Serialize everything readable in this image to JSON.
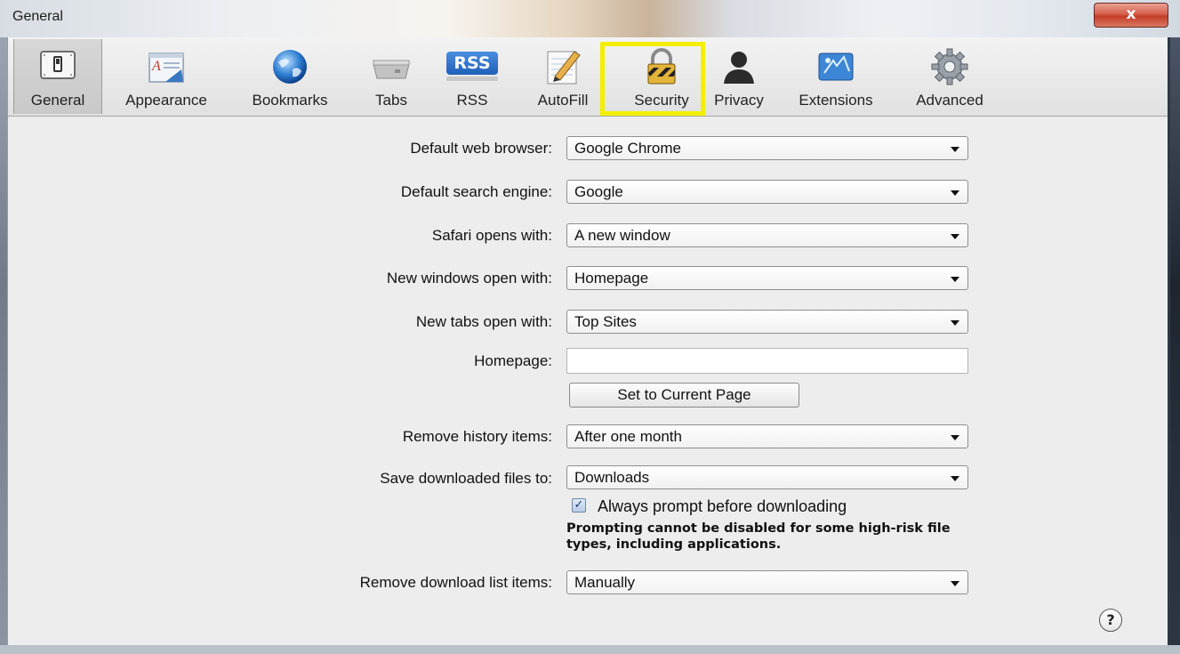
{
  "window": {
    "title": "General",
    "close_label": "x"
  },
  "toolbar": {
    "items": [
      {
        "label": "General",
        "icon": "general-switch-icon",
        "selected": true
      },
      {
        "label": "Appearance",
        "icon": "appearance-icon"
      },
      {
        "label": "Bookmarks",
        "icon": "globe-icon"
      },
      {
        "label": "Tabs",
        "icon": "tabs-icon"
      },
      {
        "label": "RSS",
        "icon": "rss-icon"
      },
      {
        "label": "AutoFill",
        "icon": "autofill-pencil-icon"
      },
      {
        "label": "Security",
        "icon": "padlock-icon",
        "highlighted": true
      },
      {
        "label": "Privacy",
        "icon": "person-silhouette-icon"
      },
      {
        "label": "Extensions",
        "icon": "extensions-icon"
      },
      {
        "label": "Advanced",
        "icon": "gear-icon"
      }
    ],
    "rss_badge": "RSS",
    "highlight_color": "#f4ef00"
  },
  "form": {
    "default_browser": {
      "label": "Default web browser:",
      "value": "Google Chrome"
    },
    "search_engine": {
      "label": "Default search engine:",
      "value": "Google"
    },
    "safari_opens": {
      "label": "Safari opens with:",
      "value": "A new window"
    },
    "new_windows": {
      "label": "New windows open with:",
      "value": "Homepage"
    },
    "new_tabs": {
      "label": "New tabs open with:",
      "value": "Top Sites"
    },
    "homepage": {
      "label": "Homepage:",
      "value": "",
      "button": "Set to Current Page"
    },
    "remove_history": {
      "label": "Remove history items:",
      "value": "After one month"
    },
    "save_downloads": {
      "label": "Save downloaded files to:",
      "value": "Downloads"
    },
    "always_prompt": {
      "checked": true,
      "check_mark": "✓",
      "label": "Always prompt before downloading",
      "note": "Prompting cannot be disabled for some high-risk file types, including applications."
    },
    "remove_download_list": {
      "label": "Remove download list items:",
      "value": "Manually"
    }
  },
  "help": {
    "label": "?"
  }
}
